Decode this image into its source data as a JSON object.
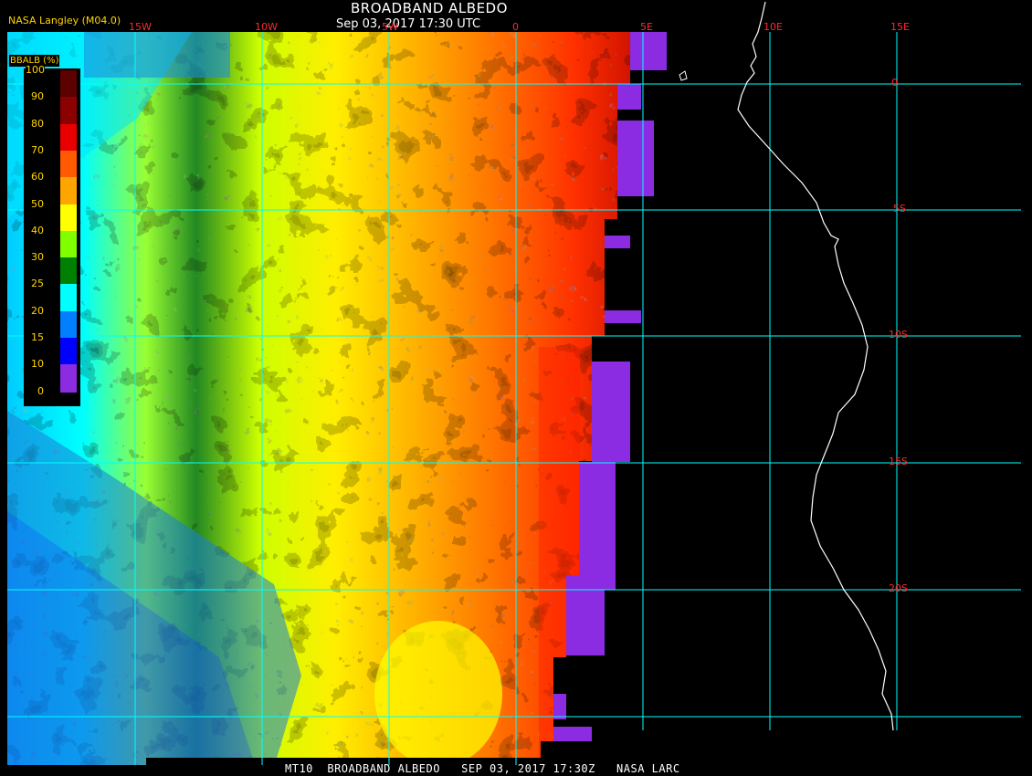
{
  "header": {
    "title": "BROADBAND ALBEDO",
    "subtitle": "Sep 03, 2017 17:30 UTC",
    "credit": "NASA Langley (M04.0)"
  },
  "footer": {
    "text": "MT10  BROADBAND ALBEDO   SEP 03, 2017 17:30Z   NASA LARC"
  },
  "legend": {
    "title": "BBALB (%)",
    "ticks": [
      "100",
      "90",
      "80",
      "70",
      "60",
      "50",
      "40",
      "30",
      "25",
      "20",
      "15",
      "10",
      "0"
    ],
    "colors": [
      "#5c0000",
      "#8b0000",
      "#e80000",
      "#ff5a00",
      "#ffa500",
      "#ffff00",
      "#80ff00",
      "#008000",
      "#00ffff",
      "#0080ff",
      "#0000ff",
      "#8b2be2"
    ]
  },
  "map": {
    "lon_labels": [
      "15W",
      "10W",
      "5W",
      "0",
      "5E",
      "10E",
      "15E"
    ],
    "lat_labels": [
      "0",
      "5S",
      "10S",
      "15S",
      "20S"
    ],
    "grid_color": "#00ffff",
    "label_color": "#ff2a2a",
    "coast_color": "#ffffff",
    "missing_color": "#8b2be2"
  }
}
